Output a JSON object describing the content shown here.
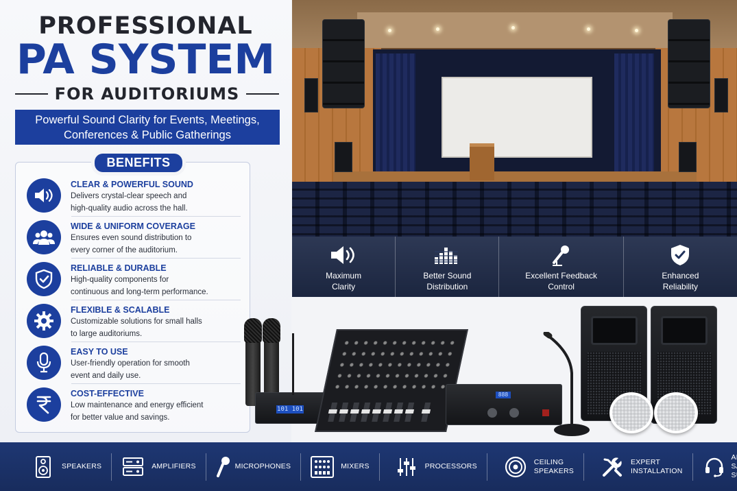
{
  "heading": {
    "line1": "PROFESSIONAL",
    "line2": "PA SYSTEM",
    "line3": "FOR AUDITORIUMS"
  },
  "tagline": {
    "line1": "Powerful Sound Clarity for Events, Meetings,",
    "line2": "Conferences & Public Gatherings"
  },
  "benefits": {
    "title": "BENEFITS",
    "items": [
      {
        "icon": "speaker-sound-icon",
        "title": "CLEAR & POWERFUL SOUND",
        "line1": "Delivers crystal-clear speech and",
        "line2": "high-quality audio across the hall."
      },
      {
        "icon": "users-group-icon",
        "title": "WIDE & UNIFORM COVERAGE",
        "line1": "Ensures even sound distribution to",
        "line2": "every corner of the auditorium."
      },
      {
        "icon": "shield-check-icon",
        "title": "RELIABLE & DURABLE",
        "line1": "High-quality components for",
        "line2": "continuous and long-term performance."
      },
      {
        "icon": "gear-icon",
        "title": "FLEXIBLE & SCALABLE",
        "line1": "Customizable solutions for small halls",
        "line2": "to large auditoriums."
      },
      {
        "icon": "microphone-icon",
        "title": "EASY TO USE",
        "line1": "User-friendly operation for smooth",
        "line2": "event and daily use."
      },
      {
        "icon": "rupee-icon",
        "title": "COST-EFFECTIVE",
        "line1": "Low maintenance and energy efficient",
        "line2": "for better value and savings."
      }
    ]
  },
  "features": [
    {
      "icon": "speaker-sound-icon",
      "line1": "Maximum",
      "line2": "Clarity"
    },
    {
      "icon": "equalizer-bars-icon",
      "line1": "Better Sound",
      "line2": "Distribution"
    },
    {
      "icon": "microphone-feedback-icon",
      "line1": "Excellent Feedback",
      "line2": "Control"
    },
    {
      "icon": "shield-check-icon",
      "line1": "Enhanced",
      "line2": "Reliability"
    }
  ],
  "products": {
    "receiver_display": "101 101",
    "amp_display": "888"
  },
  "categories": [
    {
      "icon": "speaker-box-icon",
      "line1": "SPEAKERS",
      "line2": ""
    },
    {
      "icon": "amplifier-icon",
      "line1": "AMPLIFIERS",
      "line2": ""
    },
    {
      "icon": "handheld-mic-icon",
      "line1": "MICROPHONES",
      "line2": ""
    },
    {
      "icon": "mixer-icon",
      "line1": "MIXERS",
      "line2": ""
    },
    {
      "icon": "processor-sliders-icon",
      "line1": "PROCESSORS",
      "line2": ""
    },
    {
      "icon": "ceiling-speaker-icon",
      "line1": "CEILING",
      "line2": "SPEAKERS"
    },
    {
      "icon": "tools-icon",
      "line1": "EXPERT",
      "line2": "INSTALLATION"
    },
    {
      "icon": "headset-icon",
      "line1": "AFTER SALES",
      "line2": "SUPPORT"
    }
  ],
  "colors": {
    "brand_blue": "#1c3f9e",
    "dark_text": "#23252d",
    "bottom_bar": "#1e3773"
  }
}
